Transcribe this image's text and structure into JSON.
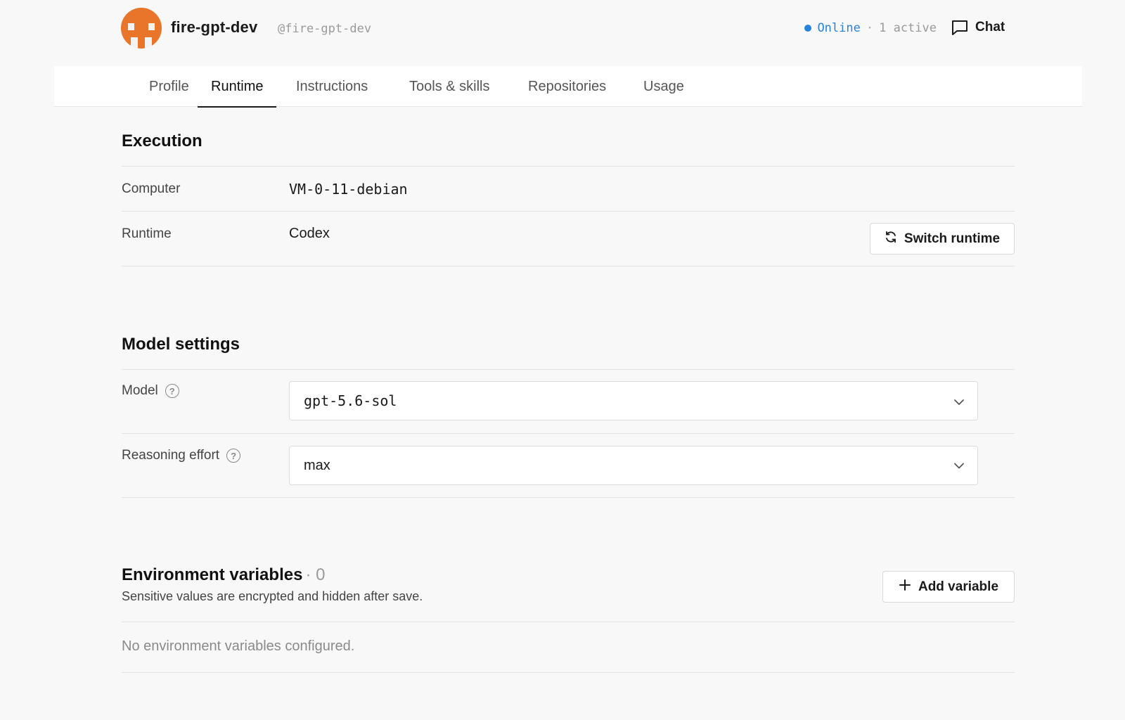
{
  "agent": {
    "name": "fire-gpt-dev",
    "handle": "@fire-gpt-dev",
    "status_online": "Online",
    "status_separator": "·",
    "status_active": "1 active",
    "chat_label": "Chat",
    "accent_color": "#2684d8",
    "avatar_color": "#e8752a"
  },
  "tabs": [
    {
      "label": "Profile",
      "active": false
    },
    {
      "label": "Runtime",
      "active": true
    },
    {
      "label": "Instructions",
      "active": false
    },
    {
      "label": "Tools & skills",
      "active": false
    },
    {
      "label": "Repositories",
      "active": false
    },
    {
      "label": "Usage",
      "active": false
    }
  ],
  "execution": {
    "title": "Execution",
    "computer_label": "Computer",
    "computer_value": "VM-0-11-debian",
    "runtime_label": "Runtime",
    "runtime_value": "Codex",
    "switch_label": "Switch runtime"
  },
  "model_settings": {
    "title": "Model settings",
    "model_label": "Model",
    "model_value": "gpt-5.6-sol",
    "effort_label": "Reasoning effort",
    "effort_value": "max",
    "help_glyph": "?"
  },
  "env": {
    "title": "Environment variables",
    "count": "· 0",
    "subtitle": "Sensitive values are encrypted and hidden after save.",
    "add_label": "Add variable",
    "empty": "No environment variables configured."
  },
  "icons": {
    "chat": "chat-bubble-icon",
    "switch": "refresh-icon",
    "add": "plus-icon",
    "help": "help-circle-icon",
    "chevron": "chevron-down-icon"
  }
}
